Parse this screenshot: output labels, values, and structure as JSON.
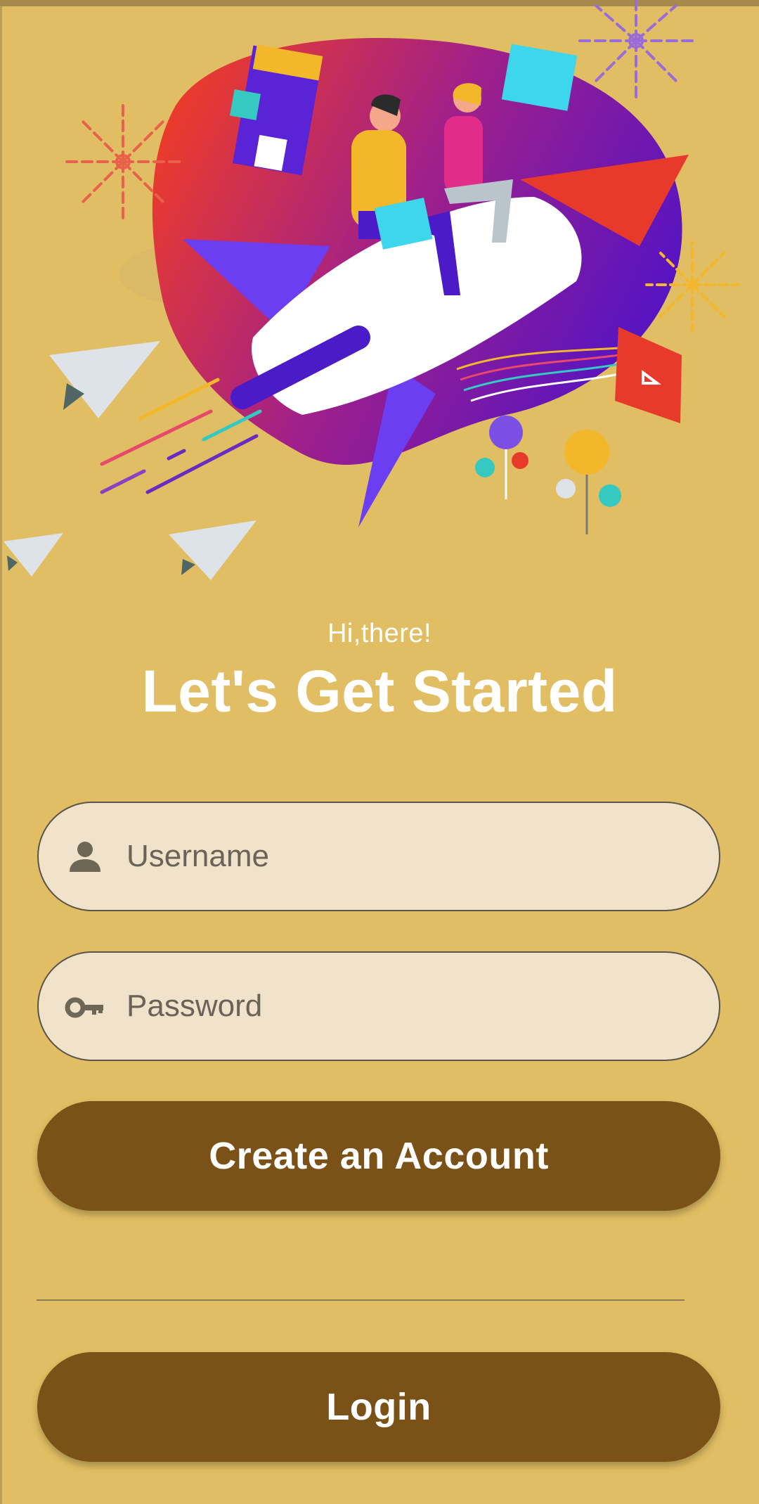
{
  "header": {
    "greeting": "Hi,there!",
    "title": "Let's Get Started"
  },
  "form": {
    "username": {
      "placeholder": "Username",
      "value": "",
      "icon": "person-icon"
    },
    "password": {
      "placeholder": "Password",
      "value": "",
      "icon": "key-icon"
    }
  },
  "actions": {
    "create_account_label": "Create an Account",
    "login_label": "Login"
  },
  "colors": {
    "background": "#E1BE63",
    "button": "#7A5116",
    "field_fill": "#F0E2CB",
    "text_light": "#FFFFFF"
  }
}
